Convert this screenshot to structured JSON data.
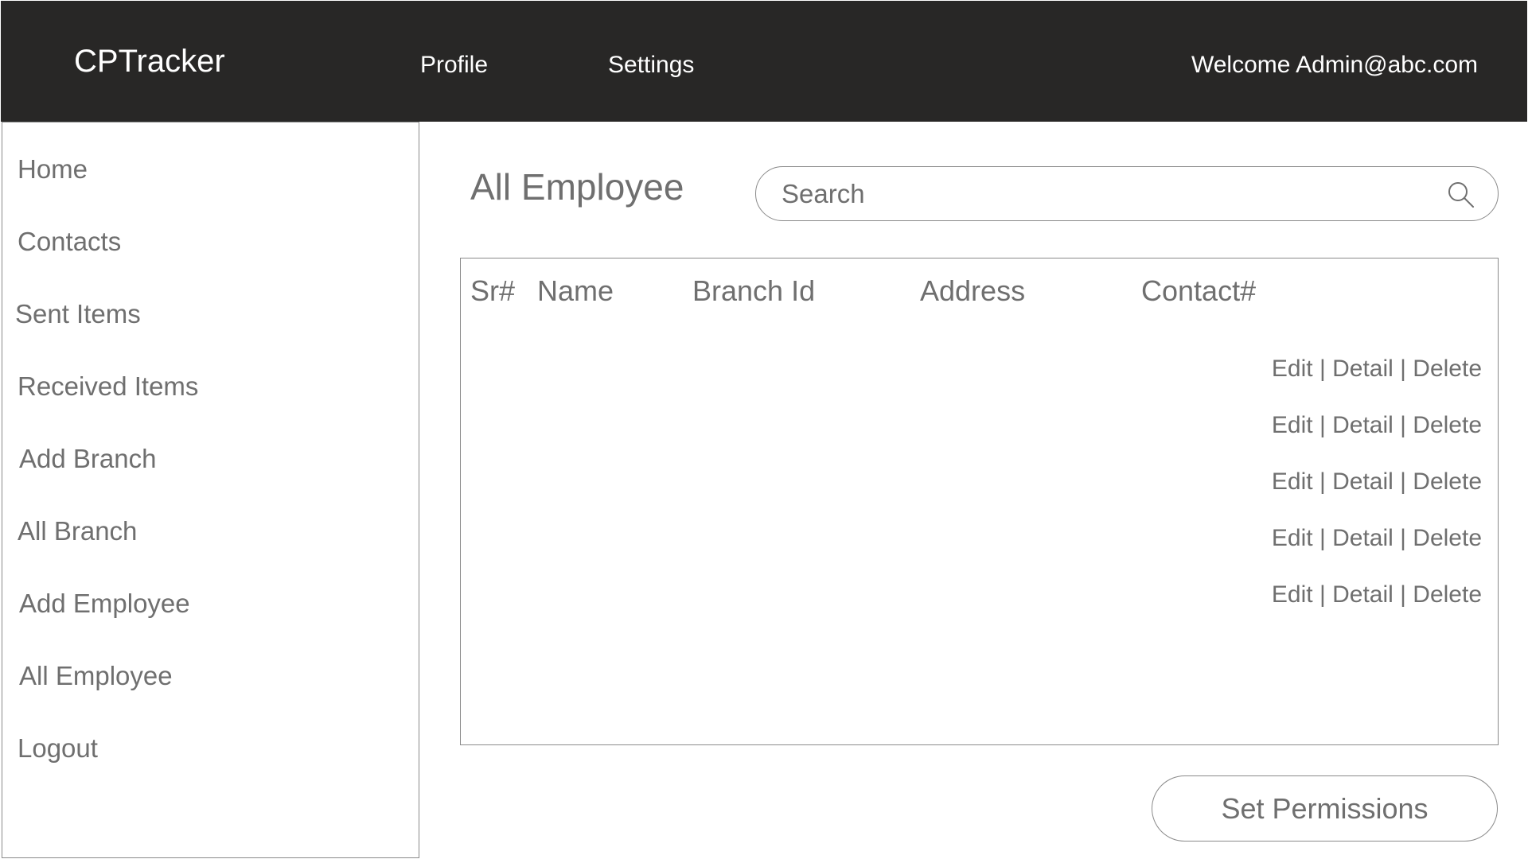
{
  "header": {
    "brand": "CPTracker",
    "nav": [
      "Profile",
      "Settings"
    ],
    "welcome": "Welcome Admin@abc.com"
  },
  "sidebar": {
    "items": [
      "Home",
      "Contacts",
      "Sent Items",
      "Received Items",
      "Add Branch",
      "All Branch",
      "Add Employee",
      "All Employee",
      "Logout"
    ]
  },
  "main": {
    "title": "All Employee",
    "search": {
      "placeholder": "Search",
      "icon": "search-icon"
    },
    "table": {
      "columns": [
        "Sr#",
        "Name",
        "Branch Id",
        "Address",
        "Contact#"
      ],
      "actions": {
        "edit": "Edit",
        "detail": "Detail",
        "delete": "Delete",
        "separator": "|"
      },
      "rows": [
        {
          "cells": [
            "",
            "",
            "",
            "",
            ""
          ]
        },
        {
          "cells": [
            "",
            "",
            "",
            "",
            ""
          ]
        },
        {
          "cells": [
            "",
            "",
            "",
            "",
            ""
          ]
        },
        {
          "cells": [
            "",
            "",
            "",
            "",
            ""
          ]
        },
        {
          "cells": [
            "",
            "",
            "",
            "",
            ""
          ]
        }
      ]
    },
    "set_permissions_label": "Set Permissions"
  },
  "colors": {
    "header_bg": "#282726",
    "header_text": "#ffffff",
    "body_text": "#6f6f6f",
    "border": "#8a8a8a"
  }
}
